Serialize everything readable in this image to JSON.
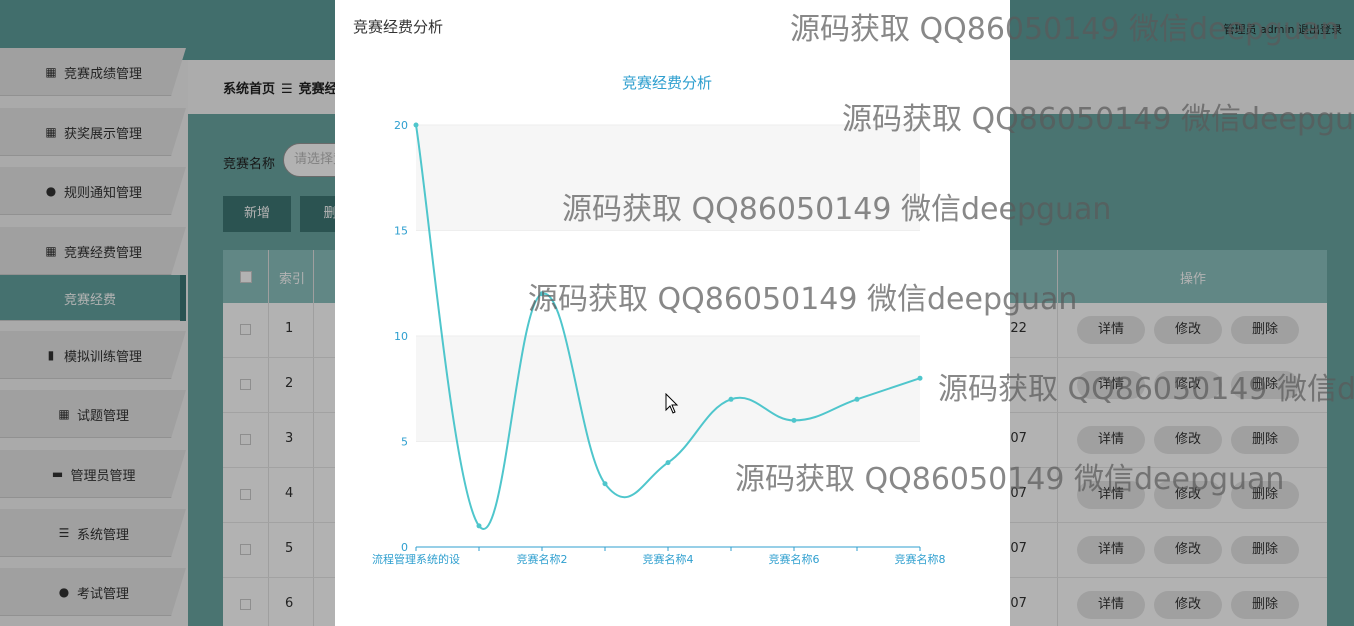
{
  "topbar": {
    "admin_info": "管理员 admin 退出登录"
  },
  "sidebar": {
    "items": [
      {
        "label": "竞赛成绩管理",
        "icon": "grid-icon"
      },
      {
        "label": "获奖展示管理",
        "icon": "grid-icon"
      },
      {
        "label": "规则通知管理",
        "icon": "user-icon"
      },
      {
        "label": "竞赛经费管理",
        "icon": "grid-icon"
      },
      {
        "label": "竞赛经费",
        "icon": ""
      },
      {
        "label": "模拟训练管理",
        "icon": "bar-chart-icon"
      },
      {
        "label": "试题管理",
        "icon": "apps-icon"
      },
      {
        "label": "管理员管理",
        "icon": "printer-icon"
      },
      {
        "label": "系统管理",
        "icon": "list-icon"
      },
      {
        "label": "考试管理",
        "icon": "bulb-icon"
      }
    ]
  },
  "breadcrumb": {
    "home": "系统首页",
    "sep": "☰",
    "current": "竞赛经"
  },
  "search": {
    "label": "竞赛名称",
    "placeholder": "请选择竞"
  },
  "toolbar": {
    "add_label": "新增",
    "delete_label": "删"
  },
  "table": {
    "headers": {
      "index": "索引",
      "actions": "操作"
    },
    "rows": [
      {
        "index": "1",
        "time": ":22"
      },
      {
        "index": "2",
        "time": ""
      },
      {
        "index": "3",
        "time": ":07"
      },
      {
        "index": "4",
        "time": ":07"
      },
      {
        "index": "5",
        "time": ":07"
      },
      {
        "index": "6",
        "time": ":07"
      }
    ],
    "actions": {
      "detail": "详情",
      "edit": "修改",
      "delete": "删除"
    }
  },
  "modal": {
    "title": "竞赛经费分析"
  },
  "chart_data": {
    "type": "line",
    "title": "竞赛经费分析",
    "x_labels_shown": [
      "流程管理系统的设",
      "竞赛名称2",
      "竞赛名称4",
      "竞赛名称6",
      "竞赛名称8"
    ],
    "values": [
      20,
      1,
      12,
      3,
      4,
      7,
      6,
      7,
      8
    ],
    "ylim": [
      0,
      20
    ],
    "yticks": [
      0,
      5,
      10,
      15,
      20
    ],
    "smooth": true,
    "grid": true,
    "colors": {
      "line": "#4fc6cc",
      "axis": "#2f9fcf",
      "band": "#f6f6f6"
    }
  },
  "watermarks": [
    "源码获取 QQ86050149 微信deepguan",
    "源码获取 QQ86050149 微信deepguan",
    "源码获取 QQ86050149 微信deepguan",
    "源码获取 QQ86050149 微信deepguan",
    "源码获取 QQ86050149 微信deepguan",
    "源码获取 QQ86050149 微信deepguan"
  ]
}
